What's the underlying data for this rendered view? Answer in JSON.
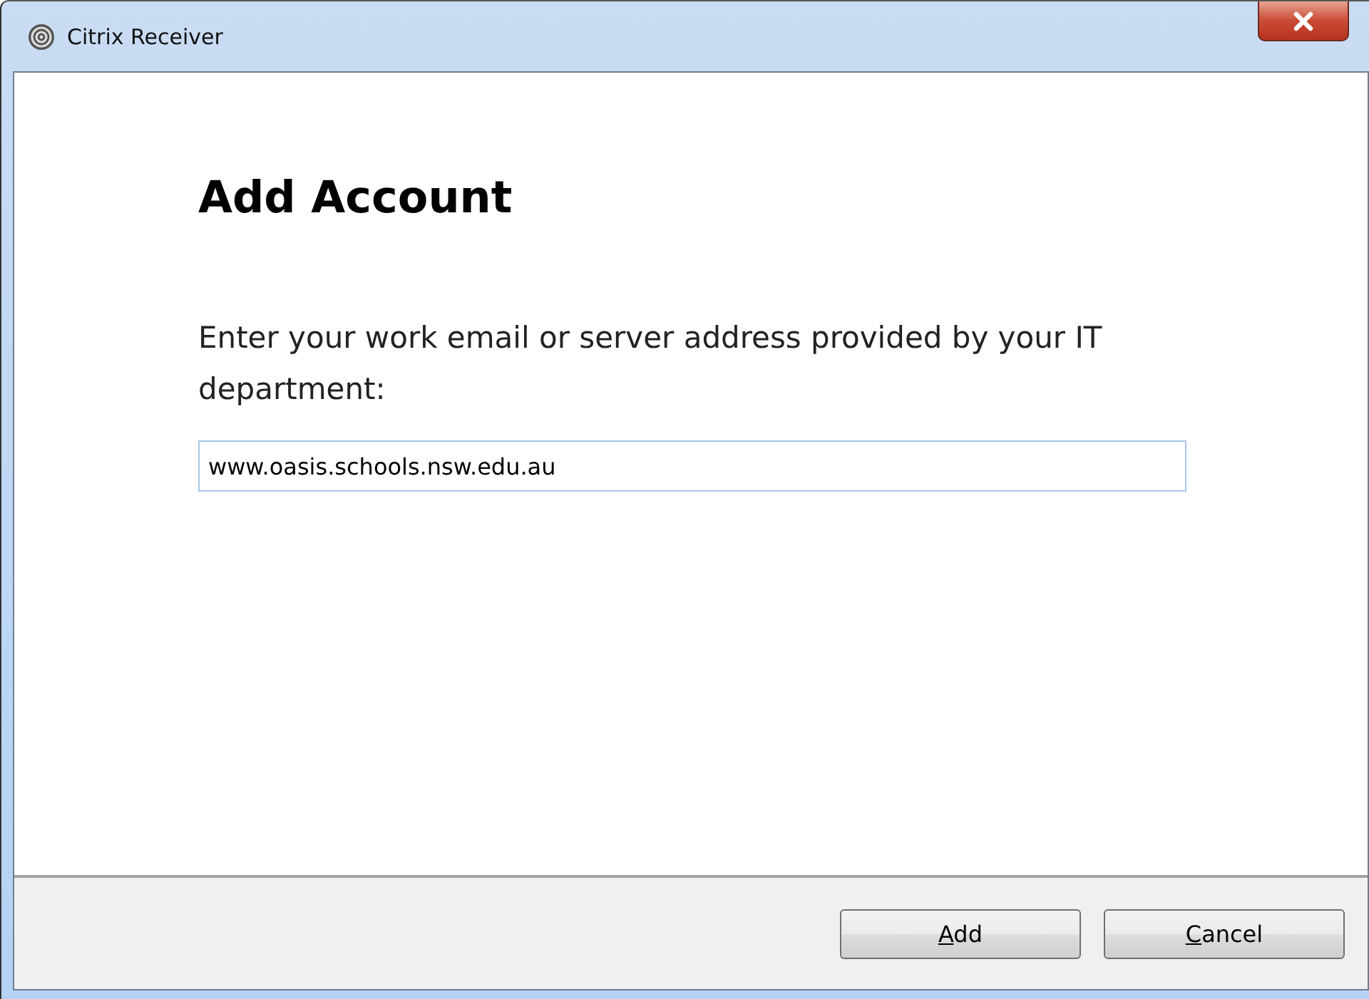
{
  "window": {
    "title": "Citrix Receiver"
  },
  "heading": "Add Account",
  "prompt": "Enter your work email or server address provided by your IT department:",
  "address_field": {
    "value": "www.oasis.schools.nsw.edu.au"
  },
  "buttons": [
    {
      "mnemonic": "A",
      "rest": "dd"
    },
    {
      "mnemonic": "C",
      "rest": "ancel"
    }
  ]
}
